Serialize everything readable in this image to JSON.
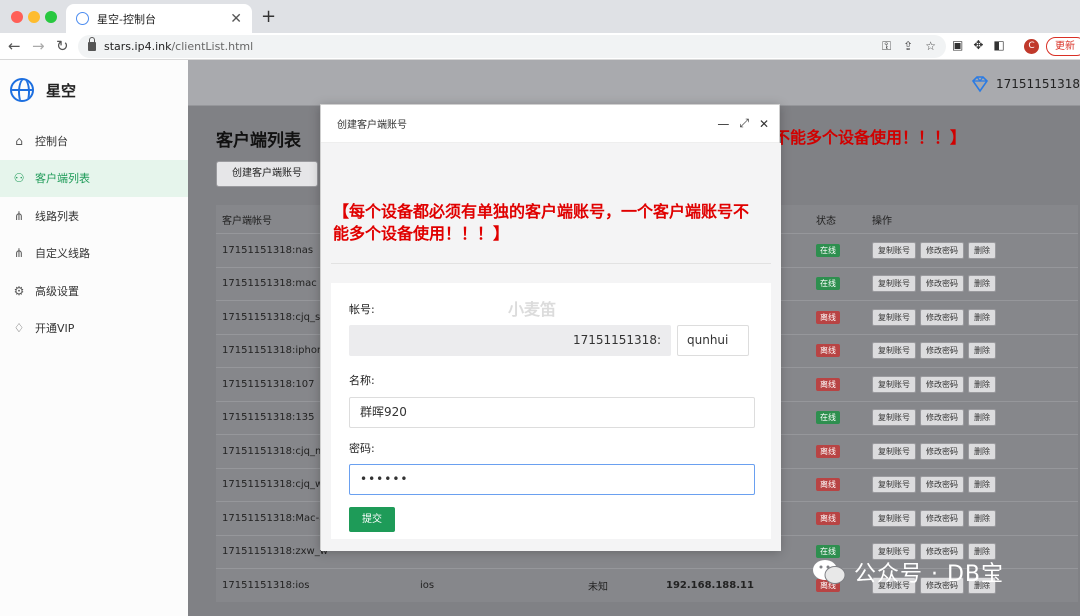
{
  "browser": {
    "tab_title": "星空-控制台",
    "url_host": "stars.ip4.ink",
    "url_path": "/clientList.html",
    "profile_initial": "C",
    "update_label": "更新"
  },
  "sidebar": {
    "brand": "星空",
    "items": [
      {
        "label": "控制台",
        "icon": "home-icon"
      },
      {
        "label": "客户端列表",
        "icon": "users-icon"
      },
      {
        "label": "线路列表",
        "icon": "network-icon"
      },
      {
        "label": "自定义线路",
        "icon": "network-icon"
      },
      {
        "label": "高级设置",
        "icon": "gear-icon"
      },
      {
        "label": "开通VIP",
        "icon": "diamond-icon"
      }
    ]
  },
  "header": {
    "user_id": "17151151318"
  },
  "main": {
    "title": "客户端列表",
    "create_button": "创建客户端账号",
    "warning_behind": "不能多个设备使用！！！】",
    "columns": [
      "客户端帐号",
      "",
      "",
      "",
      "状态",
      "操作"
    ],
    "rows": [
      {
        "account": "17151151318:nas",
        "status": "在线",
        "status_type": "on"
      },
      {
        "account": "17151151318:mac",
        "status": "在线",
        "status_type": "on"
      },
      {
        "account": "17151151318:cjq_sd",
        "status": "离线",
        "status_type": "off"
      },
      {
        "account": "17151151318:iphone",
        "status": "离线",
        "status_type": "off"
      },
      {
        "account": "17151151318:107",
        "status": "离线",
        "status_type": "off"
      },
      {
        "account": "17151151318:135",
        "status": "在线",
        "status_type": "on"
      },
      {
        "account": "17151151318:cjq_ma",
        "status": "离线",
        "status_type": "off"
      },
      {
        "account": "17151151318:cjq_wi",
        "status": "离线",
        "status_type": "off"
      },
      {
        "account": "17151151318:Mac-a",
        "status": "离线",
        "status_type": "off"
      },
      {
        "account": "17151151318:zxw_w",
        "status": "在线",
        "status_type": "on"
      },
      {
        "account": "17151151318:ios",
        "name": "ios",
        "type": "未知",
        "ip": "192.168.188.11",
        "status": "离线",
        "status_type": "off"
      }
    ],
    "ops": [
      "复制账号",
      "修改密码",
      "删除"
    ]
  },
  "modal": {
    "title": "创建客户端账号",
    "warning": "【每个设备都必须有单独的客户端账号，一个客户端账号不能多个设备使用！！！】",
    "account_label": "帐号:",
    "account_prefix": "17151151318:",
    "account_suffix": "qunhui",
    "name_label": "名称:",
    "name_value": "群晖920",
    "password_label": "密码:",
    "password_value": "••••••",
    "submit": "提交"
  },
  "overlay": {
    "watermark": "小麦笛",
    "wechat_caption": "公众号 · DB宝"
  }
}
